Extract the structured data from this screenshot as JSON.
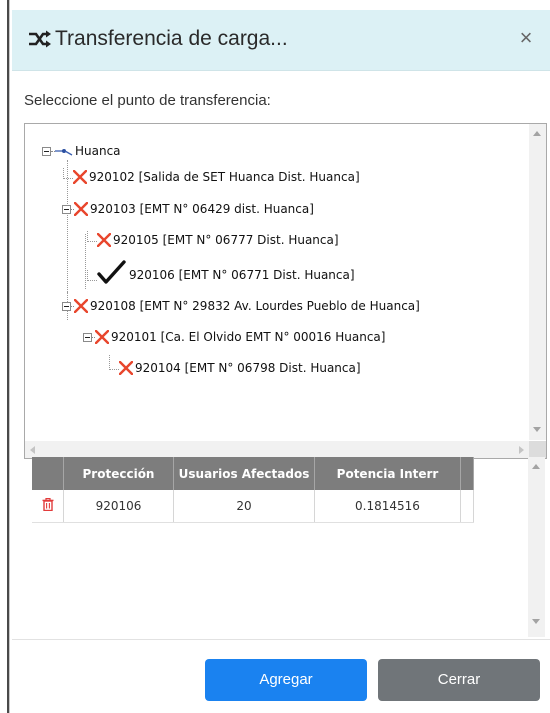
{
  "modal": {
    "title": "Transferencia de carga...",
    "close_label": "×"
  },
  "instruction": "Seleccione el punto de transferencia:",
  "tree": {
    "root": "Huanca",
    "nodes": [
      {
        "label": "920102 [Salida de SET Huanca Dist. Huanca]",
        "status": "x"
      },
      {
        "label": "920103 [EMT N° 06429 dist. Huanca]",
        "status": "x"
      },
      {
        "label": "920105 [EMT N° 06777 Dist. Huanca]",
        "status": "x"
      },
      {
        "label": "920106 [EMT N° 06771 Dist. Huanca]",
        "status": "check"
      },
      {
        "label": "920108 [EMT N° 29832 Av. Lourdes Pueblo de Huanca]",
        "status": "x"
      },
      {
        "label": "920101 [Ca. El Olvido EMT N° 00016 Huanca]",
        "status": "x"
      },
      {
        "label": "920104 [EMT N° 06798 Dist. Huanca]",
        "status": "x"
      }
    ]
  },
  "table": {
    "headers": [
      "Protección",
      "Usuarios Afectados",
      "Potencia Interr"
    ],
    "rows": [
      {
        "proteccion": "920106",
        "usuarios": "20",
        "potencia": "0.1814516"
      }
    ]
  },
  "buttons": {
    "agregar": "Agregar",
    "cerrar": "Cerrar"
  },
  "colors": {
    "header_bg": "#dcf1f5",
    "x_icon": "#e8452c",
    "primary": "#1a82f0",
    "secondary": "#707579",
    "table_header": "#7d7d7d"
  }
}
